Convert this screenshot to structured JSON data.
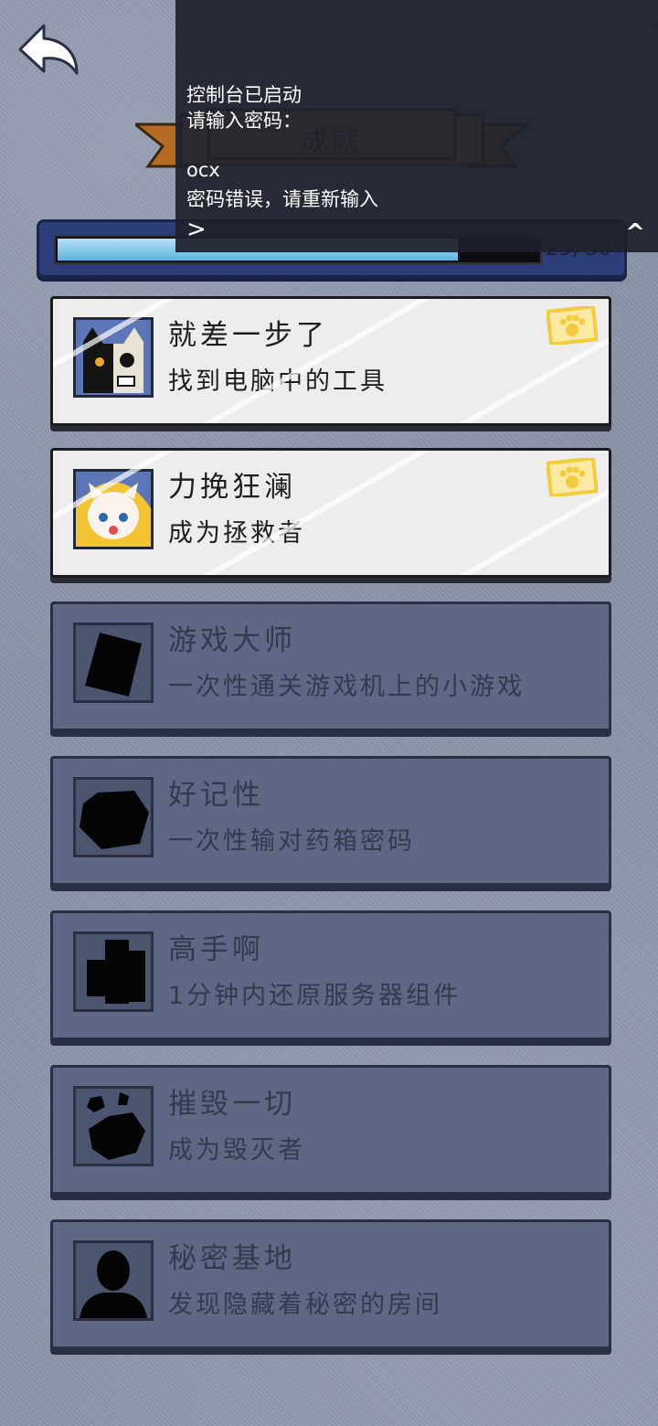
{
  "header": {
    "title": "成就"
  },
  "progress": {
    "text": "25/30",
    "unlocked": 25,
    "total": 30
  },
  "console": {
    "lines": [
      "控制台已启动",
      "请输入密码：",
      "ocx",
      "密码错误，请重新输入"
    ],
    "prompt": ">",
    "collapse_label": "^"
  },
  "achievements": [
    {
      "title": "就差一步了",
      "desc": "找到电脑中的工具",
      "unlocked": true,
      "icon": "black-cat-skull-icon"
    },
    {
      "title": "力挽狂澜",
      "desc": "成为拯救者",
      "unlocked": true,
      "icon": "white-cat-baby-icon"
    },
    {
      "title": "游戏大师",
      "desc": "一次性通关游戏机上的小游戏",
      "unlocked": false,
      "icon": "card-silhouette-icon"
    },
    {
      "title": "好记性",
      "desc": "一次性输对药箱密码",
      "unlocked": false,
      "icon": "box-silhouette-icon"
    },
    {
      "title": "高手啊",
      "desc": "1分钟内还原服务器组件",
      "unlocked": false,
      "icon": "server-silhouette-icon"
    },
    {
      "title": "摧毁一切",
      "desc": "成为毁灭者",
      "unlocked": false,
      "icon": "rubble-silhouette-icon"
    },
    {
      "title": "秘密基地",
      "desc": "发现隐藏着秘密的房间",
      "unlocked": false,
      "icon": "person-silhouette-icon"
    }
  ],
  "colors": {
    "background": "#8a93a8",
    "card_unlocked": "#ededed",
    "card_locked": "#5e6783",
    "progress_fill": "#7cc6ea",
    "banner": "#c98a35",
    "stamp": "#f2cc3c"
  }
}
